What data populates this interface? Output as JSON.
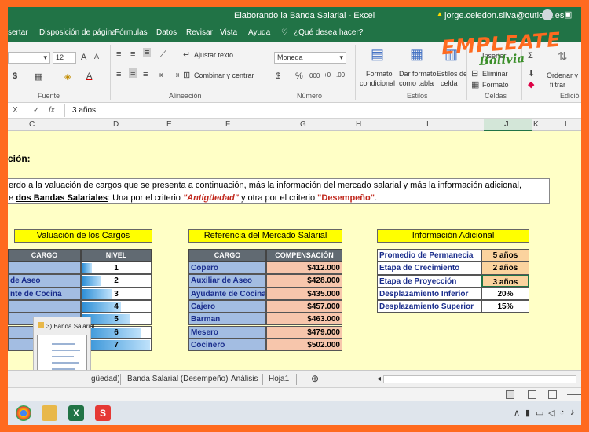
{
  "titlebar": {
    "title": "Elaborando la Banda Salarial  -  Excel",
    "user": "jorge.celedon.silva@outlook.es"
  },
  "tabs": [
    "sertar",
    "Disposición de página",
    "Fórmulas",
    "Datos",
    "Revisar",
    "Vista",
    "Ayuda",
    "¿Qué desea hacer?"
  ],
  "ribbon": {
    "font_size": "12",
    "wrap_text": "Ajustar texto",
    "merge_center": "Combinar y centrar",
    "number_format": "Moneda",
    "cond_format": [
      "Formato",
      "condicional"
    ],
    "table_format": [
      "Dar formato",
      "como tabla"
    ],
    "cell_styles": [
      "Estilos de",
      "celda"
    ],
    "insert": "Insertar",
    "delete": "Eliminar",
    "format": "Formato",
    "sort_filter": [
      "Ordenar y",
      "filtrar"
    ],
    "groups": {
      "font": "Fuente",
      "alignment": "Alineación",
      "number": "Número",
      "styles": "Estilos",
      "cells": "Celdas",
      "editing": "Edició"
    }
  },
  "formula_bar": {
    "x": "X",
    "fx": "fx",
    "value": "3 años"
  },
  "columns": [
    "C",
    "D",
    "E",
    "F",
    "G",
    "H",
    "I",
    "J",
    "K",
    "L"
  ],
  "sheet": {
    "heading": "ción:",
    "instruction_line1": "erdo a la valuación de cargos que se presenta a continuación, más la información del mercado salarial y más la información adicional,",
    "instruction_line2": {
      "prefix": "e ",
      "bold": "dos Bandas Salariales",
      "mid1": ": Una por el criterio ",
      "crit1": "\"Antigüedad\"",
      "mid2": " y otra por el criterio ",
      "crit2": "\"Desempeño\"",
      "suffix": "."
    },
    "valuation": {
      "title": "Valuación de los Cargos",
      "headers": [
        "CARGO",
        "NIVEL"
      ],
      "rows": [
        {
          "cargo": "",
          "nivel": "1",
          "bar": 0.14
        },
        {
          "cargo": "de Aseo",
          "nivel": "2",
          "bar": 0.28
        },
        {
          "cargo": "nte de Cocina",
          "nivel": "3",
          "bar": 0.43
        },
        {
          "cargo": "",
          "nivel": "4",
          "bar": 0.57
        },
        {
          "cargo": "",
          "nivel": "5",
          "bar": 0.71
        },
        {
          "cargo": "",
          "nivel": "6",
          "bar": 0.86
        },
        {
          "cargo": "",
          "nivel": "7",
          "bar": 1.0
        }
      ]
    },
    "market": {
      "title": "Referencia del Mercado Salarial",
      "headers": [
        "CARGO",
        "COMPENSACIÓN"
      ],
      "rows": [
        {
          "cargo": "Copero",
          "comp": "$412.000"
        },
        {
          "cargo": "Auxiliar de Aseo",
          "comp": "$428.000"
        },
        {
          "cargo": "Ayudante de Cocina",
          "comp": "$435.000"
        },
        {
          "cargo": "Cajero",
          "comp": "$457.000"
        },
        {
          "cargo": "Barman",
          "comp": "$463.000"
        },
        {
          "cargo": "Mesero",
          "comp": "$479.000"
        },
        {
          "cargo": "Cocinero",
          "comp": "$502.000"
        }
      ]
    },
    "additional": {
      "title": "Información Adicional",
      "rows": [
        {
          "label": "Promedio de Permanecia",
          "value": "5 años"
        },
        {
          "label": "Etapa de Crecimiento",
          "value": "2 años"
        },
        {
          "label": "Etapa de Proyección",
          "value": "3 años"
        },
        {
          "label": "Desplazamiento Inferior",
          "value": "20%"
        },
        {
          "label": "Desplazamiento Superior",
          "value": "15%"
        }
      ]
    }
  },
  "thumbnail": {
    "label": "3) Banda Salarial"
  },
  "sheet_tabs": [
    "güedad)",
    "Banda Salarial (Desempeño)",
    "Análisis",
    "Hoja1"
  ],
  "logo": {
    "line1": "EMPLEATE",
    "line2": "Bolivia"
  },
  "colors": {
    "excel_green": "#217346",
    "header_gray": "#616a72",
    "cargo_blue": "#a3bde2",
    "comp_salmon": "#f7c6ac",
    "title_yellow": "#ffff00",
    "sheet_bg": "#ffffc6",
    "frame_orange": "#ff6a1f"
  }
}
